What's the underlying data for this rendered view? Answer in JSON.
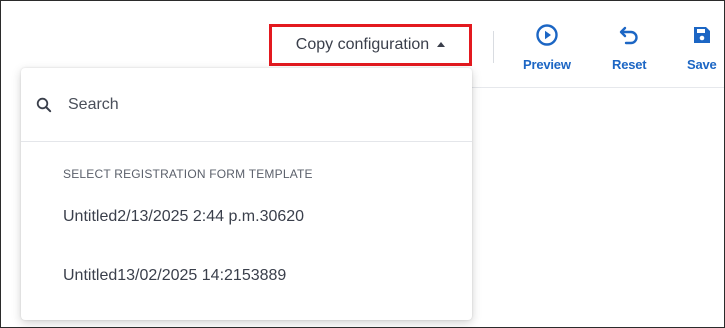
{
  "toolbar": {
    "copy_configuration_label": "Copy configuration",
    "actions": [
      {
        "label": "Preview",
        "icon": "play-circle-icon"
      },
      {
        "label": "Reset",
        "icon": "undo-arrow-icon"
      },
      {
        "label": "Save",
        "icon": "save-disk-icon"
      }
    ],
    "accent_color": "#1c66c4",
    "highlight_color": "#e3191f"
  },
  "dropdown": {
    "search_placeholder": "Search",
    "search_value": "",
    "section_title": "SELECT REGISTRATION FORM TEMPLATE",
    "options": [
      "Untitled2/13/2025 2:44 p.m.30620",
      "Untitled13/02/2025 14:2153889"
    ]
  }
}
